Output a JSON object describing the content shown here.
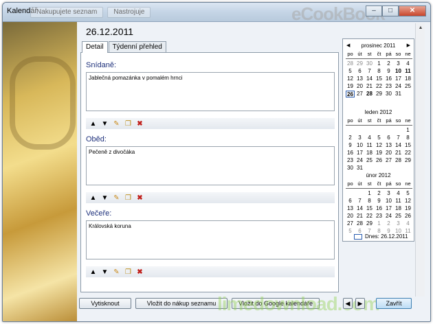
{
  "window": {
    "title": "Kalendář",
    "bg_tabs": [
      "Nakupujete seznam",
      "Nastrojuje"
    ],
    "brand": "eCookBook",
    "min": "–",
    "max": "□",
    "close": "✕"
  },
  "main": {
    "date": "26.12.2011",
    "tabs": [
      {
        "label": "Detail"
      },
      {
        "label": "Týdenní přehled"
      }
    ],
    "meals": [
      {
        "label": "Snídaně:",
        "text": "Jablečná pomazánka v pomalém hrnci"
      },
      {
        "label": "Oběd:",
        "text": "Pečeně z divočáka"
      },
      {
        "label": "Večeře:",
        "text": "Královská koruna"
      }
    ],
    "tool_icons": [
      "arrow-up-icon",
      "arrow-down-icon",
      "pencil-icon",
      "copy-icon",
      "delete-icon"
    ]
  },
  "calendar": {
    "prev": "◀",
    "next": "▶",
    "dow": [
      "po",
      "út",
      "st",
      "čt",
      "pá",
      "so",
      "ne"
    ],
    "months": [
      {
        "name": "prosinec 2011",
        "days": [
          [
            "28",
            "29",
            "30",
            "1",
            "2",
            "3",
            "4"
          ],
          [
            "5",
            "6",
            "7",
            "8",
            "9",
            "10",
            "11"
          ],
          [
            "12",
            "13",
            "14",
            "15",
            "16",
            "17",
            "18"
          ],
          [
            "19",
            "20",
            "21",
            "22",
            "23",
            "24",
            "25"
          ],
          [
            "26",
            "27",
            "28",
            "29",
            "30",
            "31",
            ""
          ]
        ]
      },
      {
        "name": "leden 2012",
        "days": [
          [
            "",
            "",
            "",
            "",
            "",
            "",
            "1"
          ],
          [
            "2",
            "3",
            "4",
            "5",
            "6",
            "7",
            "8"
          ],
          [
            "9",
            "10",
            "11",
            "12",
            "13",
            "14",
            "15"
          ],
          [
            "16",
            "17",
            "18",
            "19",
            "20",
            "21",
            "22"
          ],
          [
            "23",
            "24",
            "25",
            "26",
            "27",
            "28",
            "29"
          ],
          [
            "30",
            "31",
            "",
            "",
            "",
            "",
            ""
          ]
        ]
      },
      {
        "name": "únor 2012",
        "days": [
          [
            "",
            "",
            "1",
            "2",
            "3",
            "4",
            "5"
          ],
          [
            "6",
            "7",
            "8",
            "9",
            "10",
            "11",
            "12"
          ],
          [
            "13",
            "14",
            "15",
            "16",
            "17",
            "18",
            "19"
          ],
          [
            "20",
            "21",
            "22",
            "23",
            "24",
            "25",
            "26"
          ],
          [
            "27",
            "28",
            "29",
            "1",
            "2",
            "3",
            "4"
          ],
          [
            "5",
            "6",
            "7",
            "8",
            "9",
            "10",
            "11"
          ]
        ]
      }
    ],
    "today_label": "Dnes: 26.12.2011"
  },
  "buttons": {
    "print": "Vytisknout",
    "to_shopping": "Vložit do nákup seznamu",
    "to_google": "Vložit do Google kalendáře",
    "prev": "◀",
    "next": "▶",
    "close": "Zavřít"
  },
  "watermark": "limedownload.com"
}
